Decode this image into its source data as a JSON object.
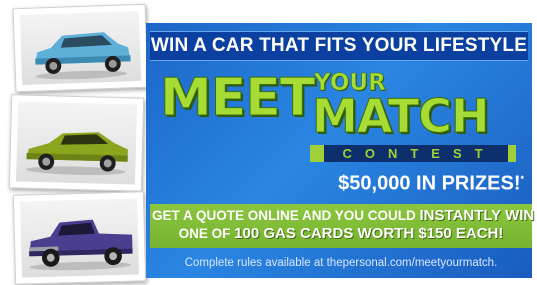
{
  "colors": {
    "panel_blue": "#2a86e2",
    "headline_band": "#0b3fa0",
    "lime": "#a6dc34",
    "green_band": "#8cc63f"
  },
  "photos": [
    {
      "name": "car-photo-blue-suv",
      "alt_icon": "blue-suv"
    },
    {
      "name": "car-photo-green-sedan",
      "alt_icon": "green-sedan"
    },
    {
      "name": "car-photo-purple-truck",
      "alt_icon": "purple-pickup-truck"
    }
  ],
  "headline": "WIN A CAR THAT FITS YOUR LIFESTYLE",
  "logo": {
    "meet": "MEET",
    "your": "YOUR",
    "match": "MATCH",
    "contest": "CONTEST"
  },
  "prizes": {
    "text": "$50,000 IN PRIZES!",
    "mark": "*"
  },
  "promo": {
    "line1_a": "GET A QUOTE ONLINE AND YOU COULD ",
    "line1_b": "INSTANTLY WIN",
    "line2_a": "ONE OF ",
    "line2_b": "100 GAS CARDS WORTH $150 EACH!"
  },
  "rules": "Complete rules available at thepersonal.com/meetyourmatch."
}
